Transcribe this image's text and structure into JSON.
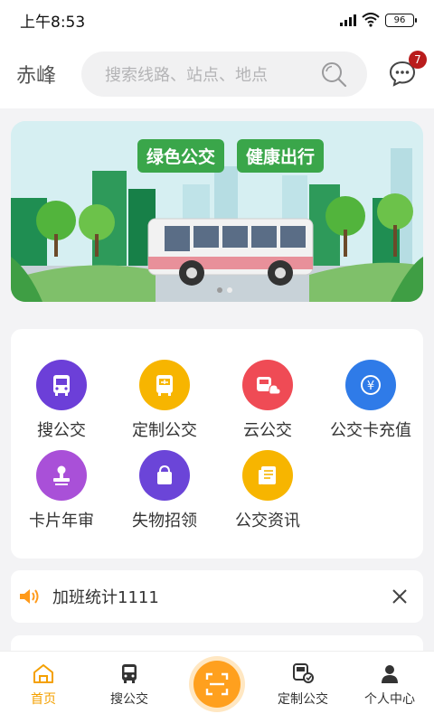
{
  "status": {
    "time": "上午8:53",
    "battery": "96"
  },
  "header": {
    "city": "赤峰",
    "search_placeholder": "搜索线路、站点、地点",
    "message_count": "7"
  },
  "banner": {
    "slogan_1": "绿色公交",
    "slogan_2": "健康出行"
  },
  "functions": [
    {
      "label": "搜公交",
      "icon": "bus-icon",
      "color": "#6c3fd8"
    },
    {
      "label": "定制公交",
      "icon": "custom-bus-icon",
      "color": "#f7b500"
    },
    {
      "label": "云公交",
      "icon": "cloud-bus-icon",
      "color": "#ef4b55"
    },
    {
      "label": "公交卡充值",
      "icon": "card-recharge-icon",
      "color": "#2f7be8"
    },
    {
      "label": "卡片年审",
      "icon": "stamp-icon",
      "color": "#a950d8"
    },
    {
      "label": "失物招领",
      "icon": "lost-found-bag-icon",
      "color": "#6b45d8"
    },
    {
      "label": "公交资讯",
      "icon": "news-icon",
      "color": "#f7b500"
    }
  ],
  "notice": {
    "text": "加班统计1111",
    "icon": "speaker-icon"
  },
  "tabbar": {
    "home": "首页",
    "search_bus": "搜公交",
    "scan": "scan-icon",
    "custom_bus": "定制公交",
    "profile": "个人中心",
    "accent": "#f4a000"
  }
}
